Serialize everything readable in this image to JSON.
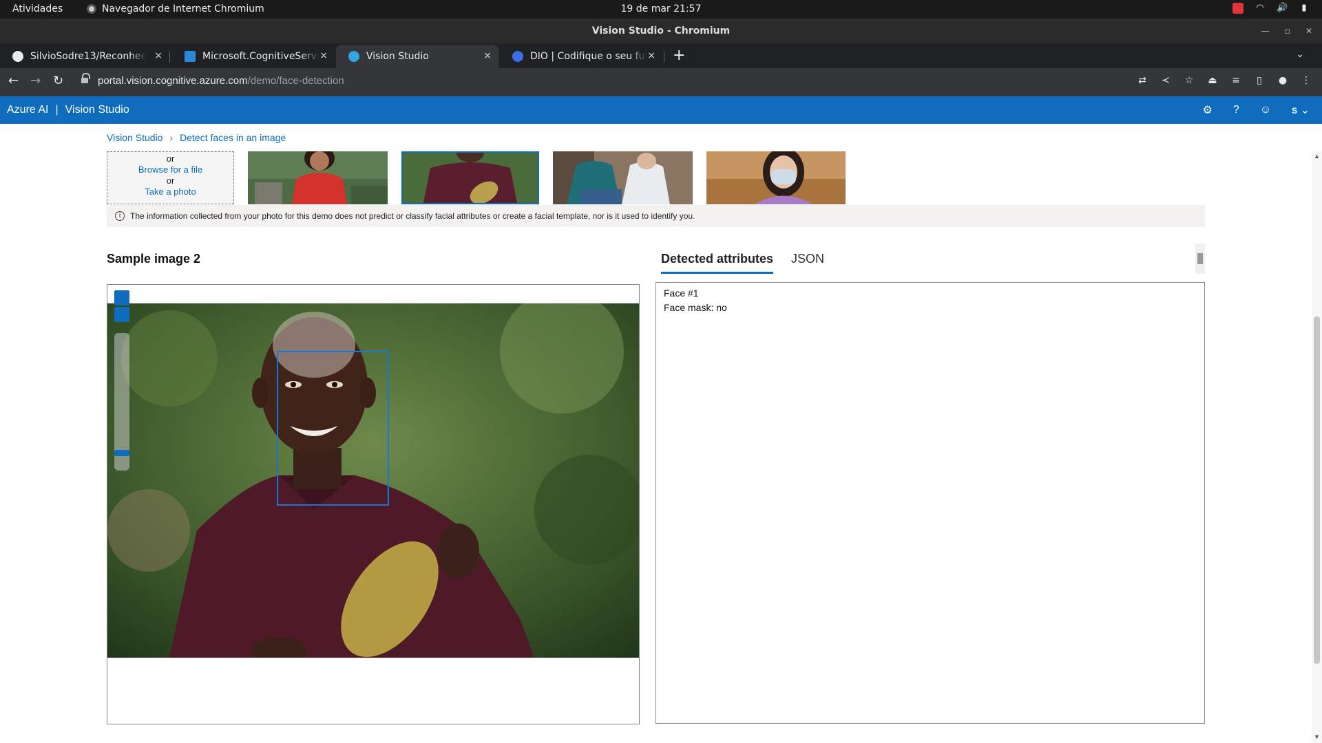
{
  "os_bar": {
    "activities": "Atividades",
    "app_name": "Navegador de Internet Chromium",
    "clock": "19 de mar  21:57"
  },
  "window": {
    "title": "Vision Studio - Chromium"
  },
  "tabs": [
    {
      "label": "SilvioSodre13/Reconhecimento",
      "close": "×",
      "favicon_color": "#e8eaed"
    },
    {
      "label": "Microsoft.CognitiveServices",
      "close": "×",
      "favicon_color": "#2b88d8"
    },
    {
      "label": "Vision Studio",
      "close": "×",
      "favicon_color": "#33a8e0"
    },
    {
      "label": "DIO | Codifique o seu futuro",
      "close": "×",
      "favicon_color": "#3b6ee8"
    }
  ],
  "new_tab": "+",
  "address_bar": {
    "host": "portal.vision.cognitive.azure.com",
    "path": "/demo/face-detection"
  },
  "azure_header": {
    "brand": "Azure AI",
    "separator": "|",
    "product": "Vision Studio",
    "avatar_initial": "S"
  },
  "breadcrumb": {
    "root": "Vision Studio",
    "current": "Detect faces in an image"
  },
  "upload": {
    "or_1": "or",
    "browse": "Browse for a file",
    "or_2": "or",
    "take_photo": "Take a photo"
  },
  "info_notice": "The information collected from your photo for this demo does not predict or classify facial attributes or create a facial template, nor is it used to identify you.",
  "sample_title": "Sample image 2",
  "result_tabs": {
    "detected": "Detected attributes",
    "json": "JSON"
  },
  "attributes": {
    "face_label": "Face #1",
    "mask_label": "Face mask: no"
  },
  "colors": {
    "azure_blue": "#0f6cbd",
    "chrome_dark": "#202124"
  }
}
